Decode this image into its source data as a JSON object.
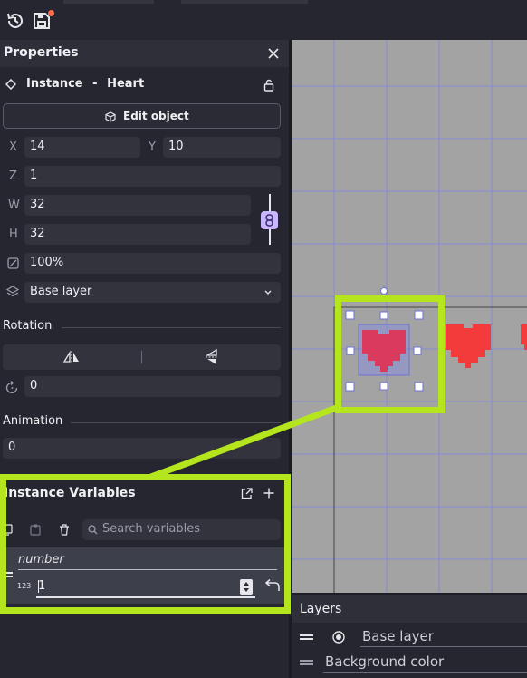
{
  "toolbar": {
    "icons": [
      "history-icon",
      "save-icon"
    ]
  },
  "properties": {
    "title": "Properties",
    "instance_label": "Instance",
    "instance_sep": "-",
    "instance_name": "Heart",
    "edit_object": "Edit object",
    "x_label": "X",
    "x_value": "14",
    "y_label": "Y",
    "y_value": "10",
    "z_label": "Z",
    "z_value": "1",
    "w_label": "W",
    "w_value": "32",
    "h_label": "H",
    "h_value": "32",
    "opacity_value": "100%",
    "layer_value": "Base layer",
    "rotation_title": "Rotation",
    "rotation_value": "0",
    "animation_title": "Animation",
    "animation_value": "0"
  },
  "instance_variables": {
    "title": "Instance Variables",
    "search_placeholder": "Search variables",
    "var_name": "number",
    "var_type_badge": "123",
    "var_value": "1"
  },
  "layers": {
    "title": "Layers",
    "items": [
      "Base layer",
      "Background color"
    ]
  },
  "colors": {
    "highlight": "#b5e61d",
    "heart": "#f33b3b",
    "selected_heart": "#d93a5e",
    "link_toggle": "#c9b6ff"
  }
}
